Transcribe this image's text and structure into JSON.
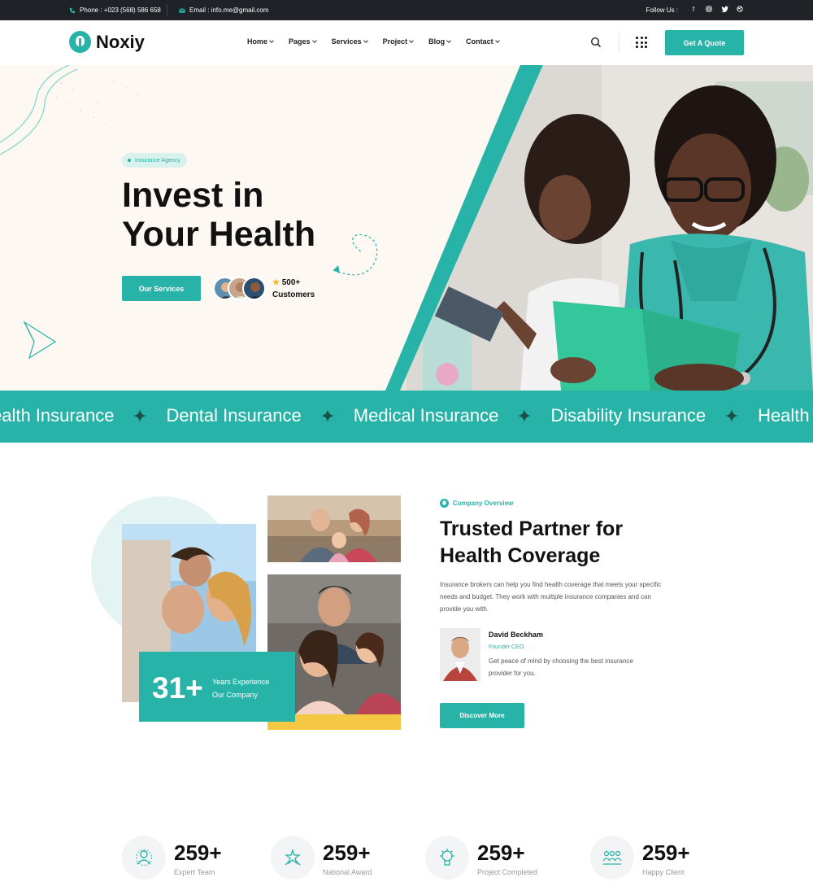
{
  "topbar": {
    "phone": "Phone : +023 (568) 586 658",
    "email": "Email : info.me@gmail.com",
    "follow_label": "Follow Us :",
    "social_icons": [
      "facebook-icon",
      "instagram-icon",
      "twitter-icon",
      "dribbble-icon"
    ]
  },
  "header": {
    "logo_text": "Noxiy",
    "nav": [
      "Home",
      "Pages",
      "Services",
      "Project",
      "Blog",
      "Contact"
    ],
    "quote_button": "Get A Quote"
  },
  "hero": {
    "badge": "Insurance Agency",
    "title_line1": "Invest in",
    "title_line2": "Your Health",
    "services_button": "Our Services",
    "customers_count": "500+",
    "customers_label": "Customers"
  },
  "marquee": {
    "items": [
      "ealth Insurance",
      "Dental Insurance",
      "Medical Insurance",
      "Disability Insurance",
      "Health"
    ]
  },
  "about": {
    "experience_number": "31+",
    "experience_line1": "Years Experience",
    "experience_line2": "Our Company",
    "tag": "Company Overview",
    "title": "Trusted Partner for Health Coverage",
    "description": "Insurance brokers can help you find health coverage that meets your specific needs and budget. They work with multiple insurance companies and can provide you with.",
    "person_name": "David Beckham",
    "person_role": "Founder CEO",
    "person_quote": "Get peace of mind by choosing the best insurance provider for you.",
    "discover_button": "Discover More"
  },
  "stats": [
    {
      "value": "259+",
      "label": "Expert Team",
      "icon": "team-icon"
    },
    {
      "value": "259+",
      "label": "National Award",
      "icon": "award-icon"
    },
    {
      "value": "259+",
      "label": "Project Completed",
      "icon": "project-icon"
    },
    {
      "value": "259+",
      "label": "Happy Client",
      "icon": "client-icon"
    }
  ],
  "colors": {
    "accent": "#27b3a8",
    "topbar_bg": "#1f2227",
    "hero_bg": "#fdf8f1"
  }
}
